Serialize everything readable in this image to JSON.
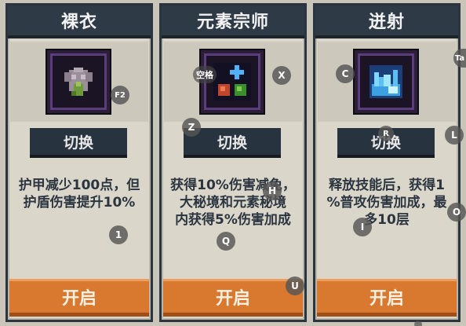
{
  "cards": [
    {
      "title": "裸衣",
      "icon": "armor-shirt-icon",
      "switch_label": "切换",
      "description": "护甲减少100点，但\n护盾伤害提升10%",
      "open_label": "开启"
    },
    {
      "title": "元素宗师",
      "icon": "element-orbs-icon",
      "switch_label": "切换",
      "description": "获得10%伤害减免，\n大秘境和元素秘境\n内获得5%伤害加成",
      "open_label": "开启"
    },
    {
      "title": "迸射",
      "icon": "blue-shards-icon",
      "switch_label": "切换",
      "description": "释放技能后，获得1\n%普攻伤害加成，最\n多10层",
      "open_label": "开启"
    }
  ],
  "key_hints": {
    "f2": "F2",
    "space": "空格",
    "x": "X",
    "z": "Z",
    "h": "H",
    "q": "Q",
    "u": "U",
    "c": "C",
    "r": "R",
    "l": "L",
    "i": "I",
    "o": "O",
    "one": "1",
    "tab": "Ta"
  },
  "colors": {
    "title_bar": "#2e3a45",
    "switch_button": "#27333e",
    "open_button": "#d8792f",
    "card_bg": "#dad6c9",
    "text": "#2b3540"
  }
}
